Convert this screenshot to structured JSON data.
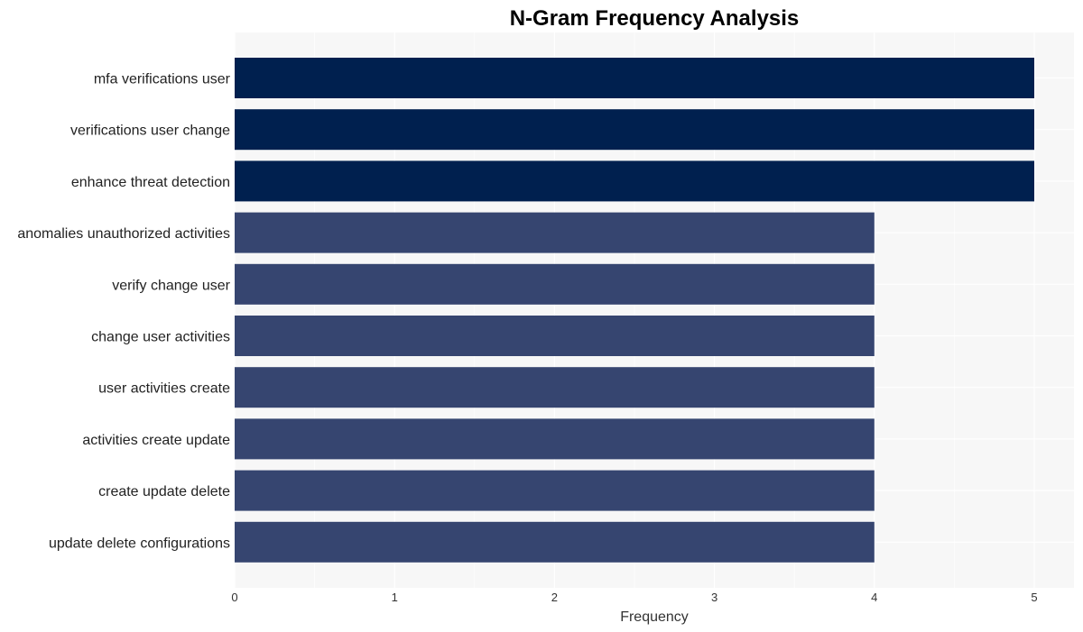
{
  "chart_data": {
    "type": "bar",
    "orientation": "horizontal",
    "title": "N-Gram Frequency Analysis",
    "xlabel": "Frequency",
    "ylabel": "",
    "categories": [
      "mfa verifications user",
      "verifications user change",
      "enhance threat detection",
      "anomalies unauthorized activities",
      "verify change user",
      "change user activities",
      "user activities create",
      "activities create update",
      "create update delete",
      "update delete configurations"
    ],
    "values": [
      5,
      5,
      5,
      4,
      4,
      4,
      4,
      4,
      4,
      4
    ],
    "colors": [
      "#00204f",
      "#00204f",
      "#00204f",
      "#364570",
      "#364570",
      "#364570",
      "#364570",
      "#364570",
      "#364570",
      "#364570"
    ],
    "xlim": [
      0,
      5.25
    ],
    "xticks": [
      "0",
      "1",
      "2",
      "3",
      "4",
      "5"
    ],
    "grid": true,
    "plot_background": "#f7f7f7",
    "legend": "none"
  }
}
